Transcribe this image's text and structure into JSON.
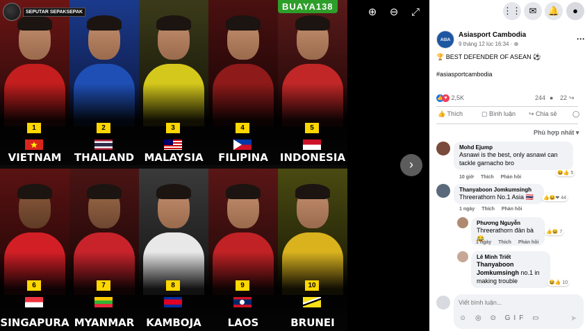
{
  "viewer": {
    "zoom_in_icon": "zoom-in-icon",
    "zoom_out_icon": "zoom-out-icon",
    "fullscreen_icon": "fullscreen-icon",
    "next_icon": "chevron-right-icon"
  },
  "poster": {
    "brand_left": "SEPUTAR SEPAKSEPAK",
    "brand_right": "BUAYA138",
    "players": [
      {
        "rank": "1",
        "country": "VIETNAM"
      },
      {
        "rank": "2",
        "country": "THAILAND"
      },
      {
        "rank": "3",
        "country": "MALAYSIA"
      },
      {
        "rank": "4",
        "country": "FILIPINA"
      },
      {
        "rank": "5",
        "country": "INDONESIA"
      },
      {
        "rank": "6",
        "country": "SINGAPURA"
      },
      {
        "rank": "7",
        "country": "MYANMAR"
      },
      {
        "rank": "8",
        "country": "KAMBOJA"
      },
      {
        "rank": "9",
        "country": "LAOS"
      },
      {
        "rank": "10",
        "country": "BRUNEI"
      }
    ]
  },
  "topbar": {
    "menu_icon": "grid-menu-icon",
    "messenger_icon": "messenger-icon",
    "bell_icon": "bell-icon",
    "profile_icon": "profile-avatar-icon"
  },
  "post": {
    "page_name": "Asiasport Cambodia",
    "avatar_label": "ASIA",
    "time": "9 tháng 12 lúc 16:34 · ⊕",
    "text": "🏆 BEST DEFENDER OF ASEAN ⚽",
    "hashtag": "#asiasportcambodia",
    "reactions_count": "2,5K",
    "comments_count": "244",
    "shares_count": "22",
    "actions": {
      "like": "Thích",
      "comment": "Bình luận",
      "share": "Chia sẻ"
    },
    "sort_label": "Phù hợp nhất ▾"
  },
  "comments": [
    {
      "author": "Mohd Ejump",
      "text": "Asnawi is the best, only asnawi can tackle garnacho bro",
      "time": "10 giờ",
      "like": "Thích",
      "reply": "Phản hồi",
      "reactions": "5"
    },
    {
      "author": "Thanyaboon Jomkumsingh",
      "text": "Threerathorn No.1 Asia 🇹🇭",
      "time": "1 ngày",
      "like": "Thích",
      "reply": "Phản hồi",
      "reactions": "44"
    },
    {
      "author": "Phương Nguyễn",
      "text": "Threerathorn đản bà 😂",
      "time": "1 ngày",
      "like": "Thích",
      "reply": "Phản hồi",
      "reactions": "7"
    },
    {
      "author": "Lê Minh Triết",
      "mention": "Thanyaboon Jomkumsingh",
      "text": "no.1 in making trouble",
      "reactions": "10"
    }
  ],
  "composer": {
    "placeholder": "Viết bình luận...",
    "icons": "☺ ◎ ⊙ GIF ▭",
    "send_icon": "➤"
  },
  "colors": {
    "accent": "#1877f2",
    "badge": "#ffd700",
    "bubble": "#f0f2f5"
  }
}
